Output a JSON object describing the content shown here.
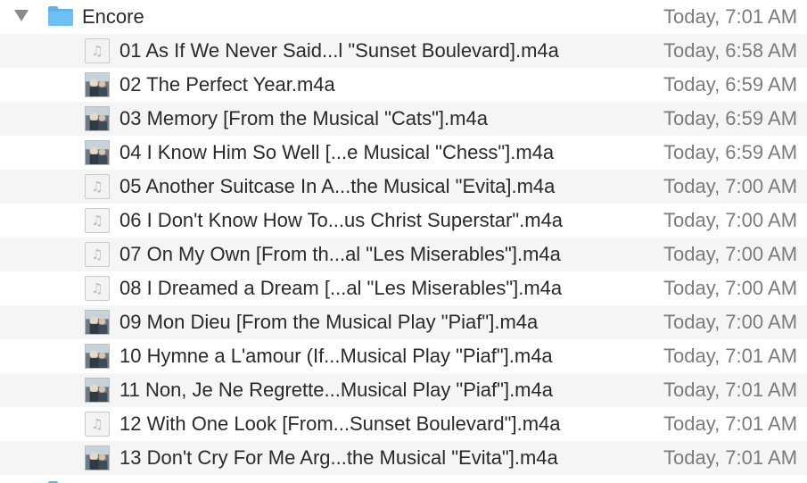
{
  "folder": {
    "name": "Encore",
    "date": "Today, 7:01 AM",
    "icon": "folder-icon"
  },
  "files": [
    {
      "name": "01 As If We Never Said...l \"Sunset Boulevard].m4a",
      "date": "Today, 6:58 AM",
      "icon": "music-note-icon"
    },
    {
      "name": "02 The Perfect Year.m4a",
      "date": "Today, 6:59 AM",
      "icon": "album-art-icon"
    },
    {
      "name": "03 Memory [From the Musical \"Cats\"].m4a",
      "date": "Today, 6:59 AM",
      "icon": "album-art-icon"
    },
    {
      "name": "04 I Know Him So Well [...e Musical \"Chess\"].m4a",
      "date": "Today, 6:59 AM",
      "icon": "album-art-icon"
    },
    {
      "name": "05 Another Suitcase In A...the Musical \"Evita].m4a",
      "date": "Today, 7:00 AM",
      "icon": "music-note-icon"
    },
    {
      "name": "06 I Don't Know How To...us Christ Superstar\".m4a",
      "date": "Today, 7:00 AM",
      "icon": "music-note-icon"
    },
    {
      "name": "07 On My Own [From th...al \"Les Miserables\"].m4a",
      "date": "Today, 7:00 AM",
      "icon": "music-note-icon"
    },
    {
      "name": "08 I Dreamed a Dream [...al \"Les Miserables\"].m4a",
      "date": "Today, 7:00 AM",
      "icon": "music-note-icon"
    },
    {
      "name": "09 Mon Dieu [From the Musical Play \"Piaf\"].m4a",
      "date": "Today, 7:00 AM",
      "icon": "album-art-icon"
    },
    {
      "name": "10 Hymne a L'amour (If...Musical Play \"Piaf\"].m4a",
      "date": "Today, 7:01 AM",
      "icon": "album-art-icon"
    },
    {
      "name": "11 Non, Je Ne Regrette...Musical Play \"Piaf\"].m4a",
      "date": "Today, 7:01 AM",
      "icon": "album-art-icon"
    },
    {
      "name": "12 With One Look [From...Sunset Boulevard\"].m4a",
      "date": "Today, 7:01 AM",
      "icon": "music-note-icon"
    },
    {
      "name": "13 Don't Cry For Me Arg...the Musical \"Evita\"].m4a",
      "date": "Today, 7:01 AM",
      "icon": "album-art-icon"
    }
  ],
  "colors": {
    "folder_blue": "#5db3ee",
    "stripe": "#f4f5f5",
    "text": "#2a2a2a",
    "date_text": "#7b7b7b"
  }
}
